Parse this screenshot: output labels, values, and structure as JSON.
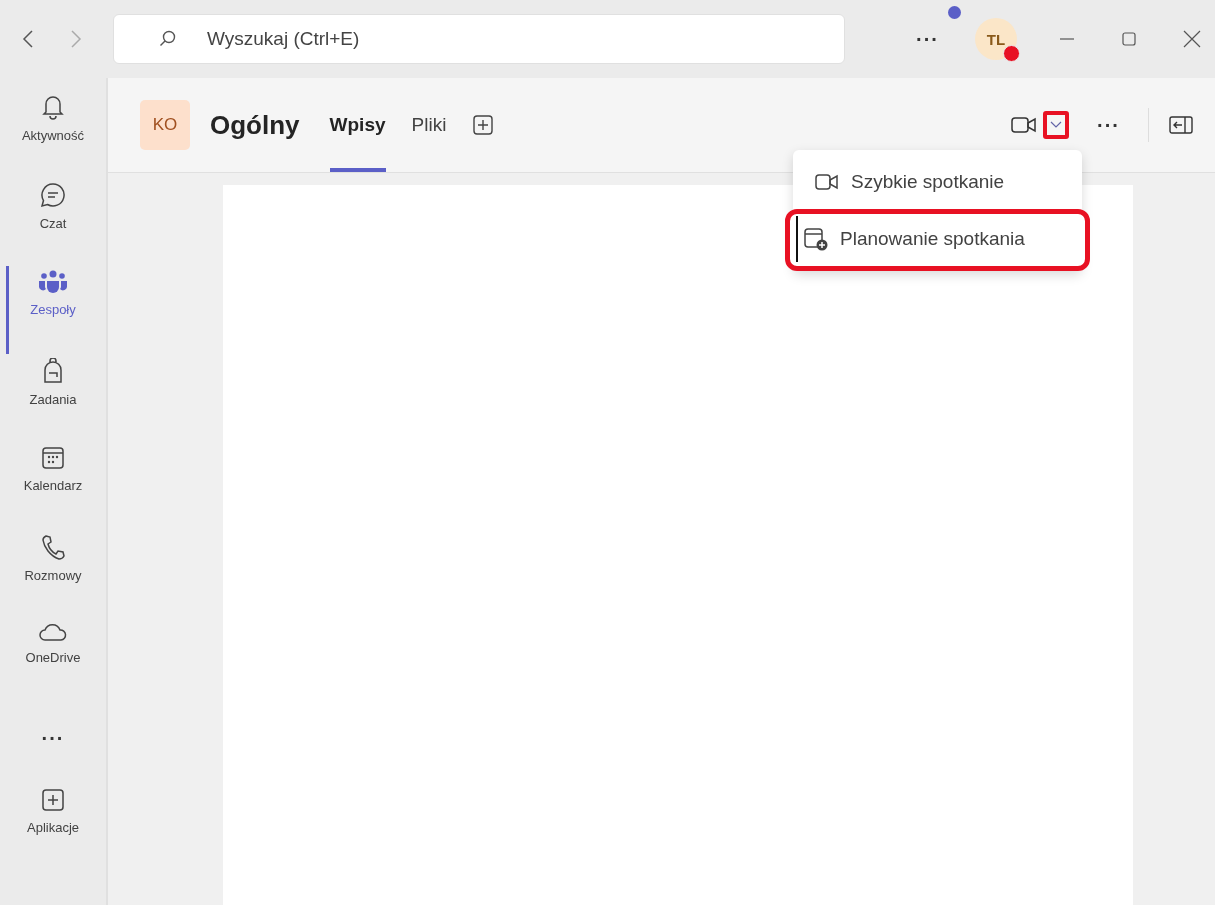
{
  "search": {
    "placeholder": "Wyszukaj (Ctrl+E)"
  },
  "topbar": {
    "more": "···",
    "notification_dot": true,
    "avatar": {
      "initials": "TL"
    }
  },
  "rail": {
    "items": [
      {
        "kind": "bell",
        "label": "Aktywność",
        "selected": false
      },
      {
        "kind": "chat",
        "label": "Czat",
        "selected": false
      },
      {
        "kind": "teams",
        "label": "Zespoły",
        "selected": true
      },
      {
        "kind": "backpack",
        "label": "Zadania",
        "selected": false
      },
      {
        "kind": "calendar",
        "label": "Kalendarz",
        "selected": false
      },
      {
        "kind": "phone",
        "label": "Rozmowy",
        "selected": false
      },
      {
        "kind": "cloud",
        "label": "OneDrive",
        "selected": false
      }
    ],
    "more": "···",
    "apps": {
      "label": "Aplikacje"
    }
  },
  "channel": {
    "team_initials": "KO",
    "name": "Ogólny",
    "tabs": [
      {
        "label": "Wpisy",
        "selected": true
      },
      {
        "label": "Pliki",
        "selected": false
      }
    ],
    "more": "···"
  },
  "meet_dropdown": {
    "highlighted": true
  },
  "menu": {
    "items": [
      {
        "kind": "video",
        "label": "Szybkie spotkanie",
        "highlighted": false
      },
      {
        "kind": "schedule",
        "label": "Planowanie spotkania",
        "highlighted": true
      }
    ]
  }
}
